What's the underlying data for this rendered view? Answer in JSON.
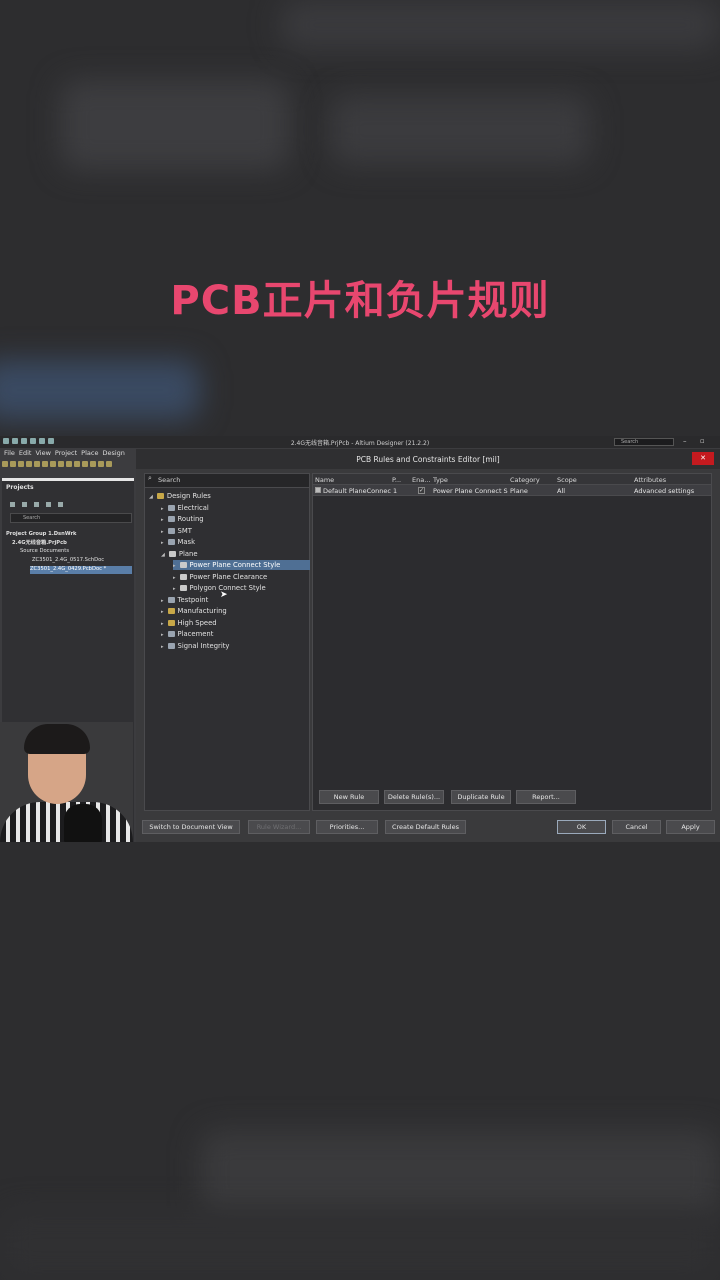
{
  "headline": "PCB正片和负片规则",
  "app": {
    "title": "2.4G无线音箱.PrjPcb - Altium Designer (21.2.2)",
    "title_search": "Search",
    "menu": [
      "File",
      "Edit",
      "View",
      "Project",
      "Place",
      "Design"
    ]
  },
  "projects_panel": {
    "title": "Projects",
    "search_placeholder": "Search",
    "tree": [
      "Project Group 1.DsnWrk",
      "2.4G无线音箱.PrjPcb",
      "Source Documents",
      "ZC3501_2.4G_0517.SchDoc",
      "ZC3501_2.4G_0429.PcbDoc *"
    ]
  },
  "dialog": {
    "title": "PCB Rules and Constraints Editor [mil]",
    "close_label": "✕",
    "search_placeholder": "Search",
    "tree": {
      "root": "Design Rules",
      "categories": [
        "Electrical",
        "Routing",
        "SMT",
        "Mask",
        "Plane"
      ],
      "plane_children": [
        "Power Plane Connect Style",
        "Power Plane Clearance",
        "Polygon Connect Style"
      ],
      "more_categories": [
        "Testpoint",
        "Manufacturing",
        "High Speed",
        "Placement",
        "Signal Integrity"
      ],
      "selected": "Power Plane Connect Style"
    },
    "grid": {
      "columns": [
        "Name",
        "P...",
        "Ena...",
        "Type",
        "Category",
        "Scope",
        "Attributes"
      ],
      "rows": [
        {
          "name": "Default PlaneConnect",
          "priority": "1",
          "enabled": "✓",
          "type": "Power Plane Connect S",
          "category": "Plane",
          "scope": "All",
          "attributes": "Advanced settings"
        }
      ]
    },
    "rule_buttons": [
      "New Rule",
      "Delete Rule(s)...",
      "Duplicate Rule",
      "Report..."
    ],
    "footer_buttons": {
      "switch_view": "Switch to Document View",
      "rule_wizard": "Rule Wizard...",
      "priorities": "Priorities...",
      "create_default": "Create Default Rules",
      "ok": "OK",
      "cancel": "Cancel",
      "apply": "Apply"
    }
  }
}
